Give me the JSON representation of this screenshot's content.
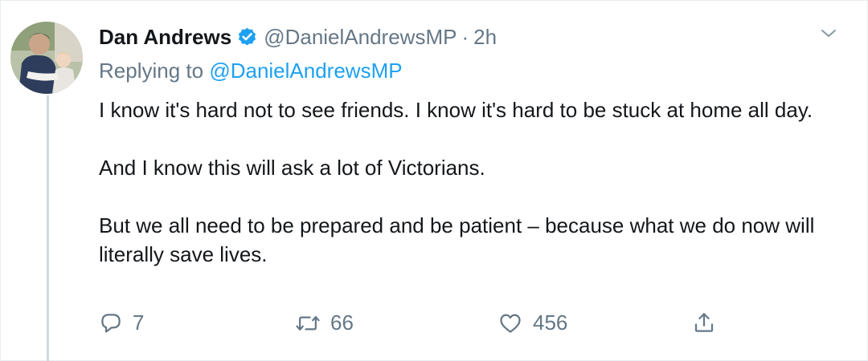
{
  "tweet": {
    "display_name": "Dan Andrews",
    "verified": true,
    "handle": "@DanielAndrewsMP",
    "separator": "·",
    "time": "2h",
    "replying_prefix": "Replying to",
    "replying_to": "@DanielAndrewsMP",
    "paragraphs": [
      "I know it's hard not to see friends. I know it's hard to be stuck at home all day.",
      "And I know this will ask a lot of Victorians.",
      "But we all need to be prepared and be patient – because what we do now will literally save lives."
    ],
    "actions": {
      "reply_count": "7",
      "retweet_count": "66",
      "like_count": "456"
    }
  },
  "icons": {
    "verified": "verified-badge-icon",
    "caret": "chevron-down-icon",
    "reply": "reply-icon",
    "retweet": "retweet-icon",
    "like": "heart-icon",
    "share": "share-icon"
  },
  "colors": {
    "text": "#14171a",
    "secondary": "#657786",
    "link": "#1da1f2",
    "verified": "#1da1f2",
    "thread_line": "#cfd9de"
  }
}
